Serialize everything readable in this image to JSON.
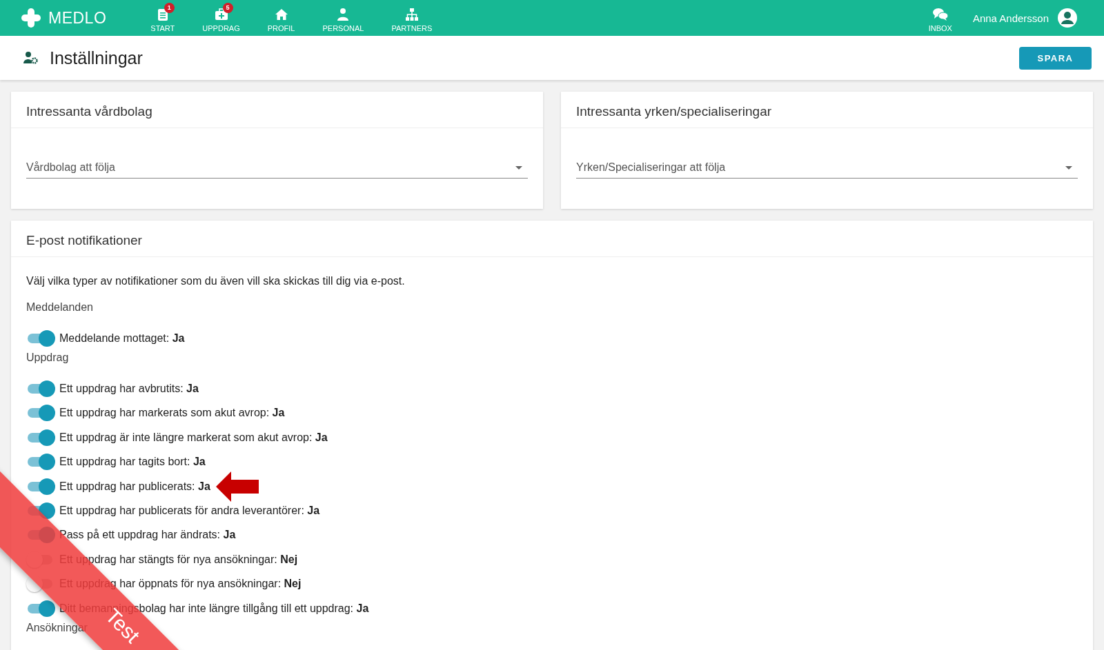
{
  "app": {
    "logo": "MEDLO",
    "nav": [
      {
        "label": "START",
        "badge": "1"
      },
      {
        "label": "UPPDRAG",
        "badge": "5"
      },
      {
        "label": "PROFIL"
      },
      {
        "label": "PERSONAL"
      },
      {
        "label": "PARTNERS"
      }
    ],
    "inbox": "INBOX",
    "user": "Anna Andersson"
  },
  "page": {
    "title": "Inställningar",
    "save_button": "SPARA"
  },
  "cards": [
    {
      "title": "Intressanta vårdbolag",
      "placeholder": "Vårdbolag att följa"
    },
    {
      "title": "Intressanta yrken/specialiseringar",
      "placeholder": "Yrken/Specialiseringar att följa"
    }
  ],
  "notifications": {
    "title": "E-post notifikationer",
    "intro": "Välj vilka typer av notifikationer som du även vill ska skickas till dig via e-post.",
    "groups": [
      {
        "title": "Meddelanden",
        "items": [
          {
            "label": "Meddelande mottaget: **Ja**",
            "on": true
          }
        ]
      },
      {
        "title": "Uppdrag",
        "items": [
          {
            "label": "Ett uppdrag har avbrutits: **Ja**",
            "on": true
          },
          {
            "label": "Ett uppdrag har markerats som akut avrop: **Ja**",
            "on": true
          },
          {
            "label": "Ett uppdrag är inte längre markerat som akut avrop: **Ja**",
            "on": true
          },
          {
            "label": "Ett uppdrag har tagits bort: **Ja**",
            "on": true
          },
          {
            "label": "Ett uppdrag har publicerats: **Ja**",
            "on": true,
            "pointer": true
          },
          {
            "label": "Ett uppdrag har publicerats för andra leverantörer: **Ja**",
            "on": true
          },
          {
            "label": "Pass på ett uppdrag har ändrats: **Ja**",
            "on": true
          },
          {
            "label": "Ett uppdrag har stängts för nya ansökningar: **Nej**",
            "on": false
          },
          {
            "label": "Ett uppdrag har öppnats för nya ansökningar: **Nej**",
            "on": false
          },
          {
            "label": "Ditt bemanningsbolag har inte längre tillgång till ett uppdrag: **Ja**",
            "on": true
          }
        ]
      },
      {
        "title": "Ansökningar"
      }
    ]
  },
  "ribbon": "Test"
}
